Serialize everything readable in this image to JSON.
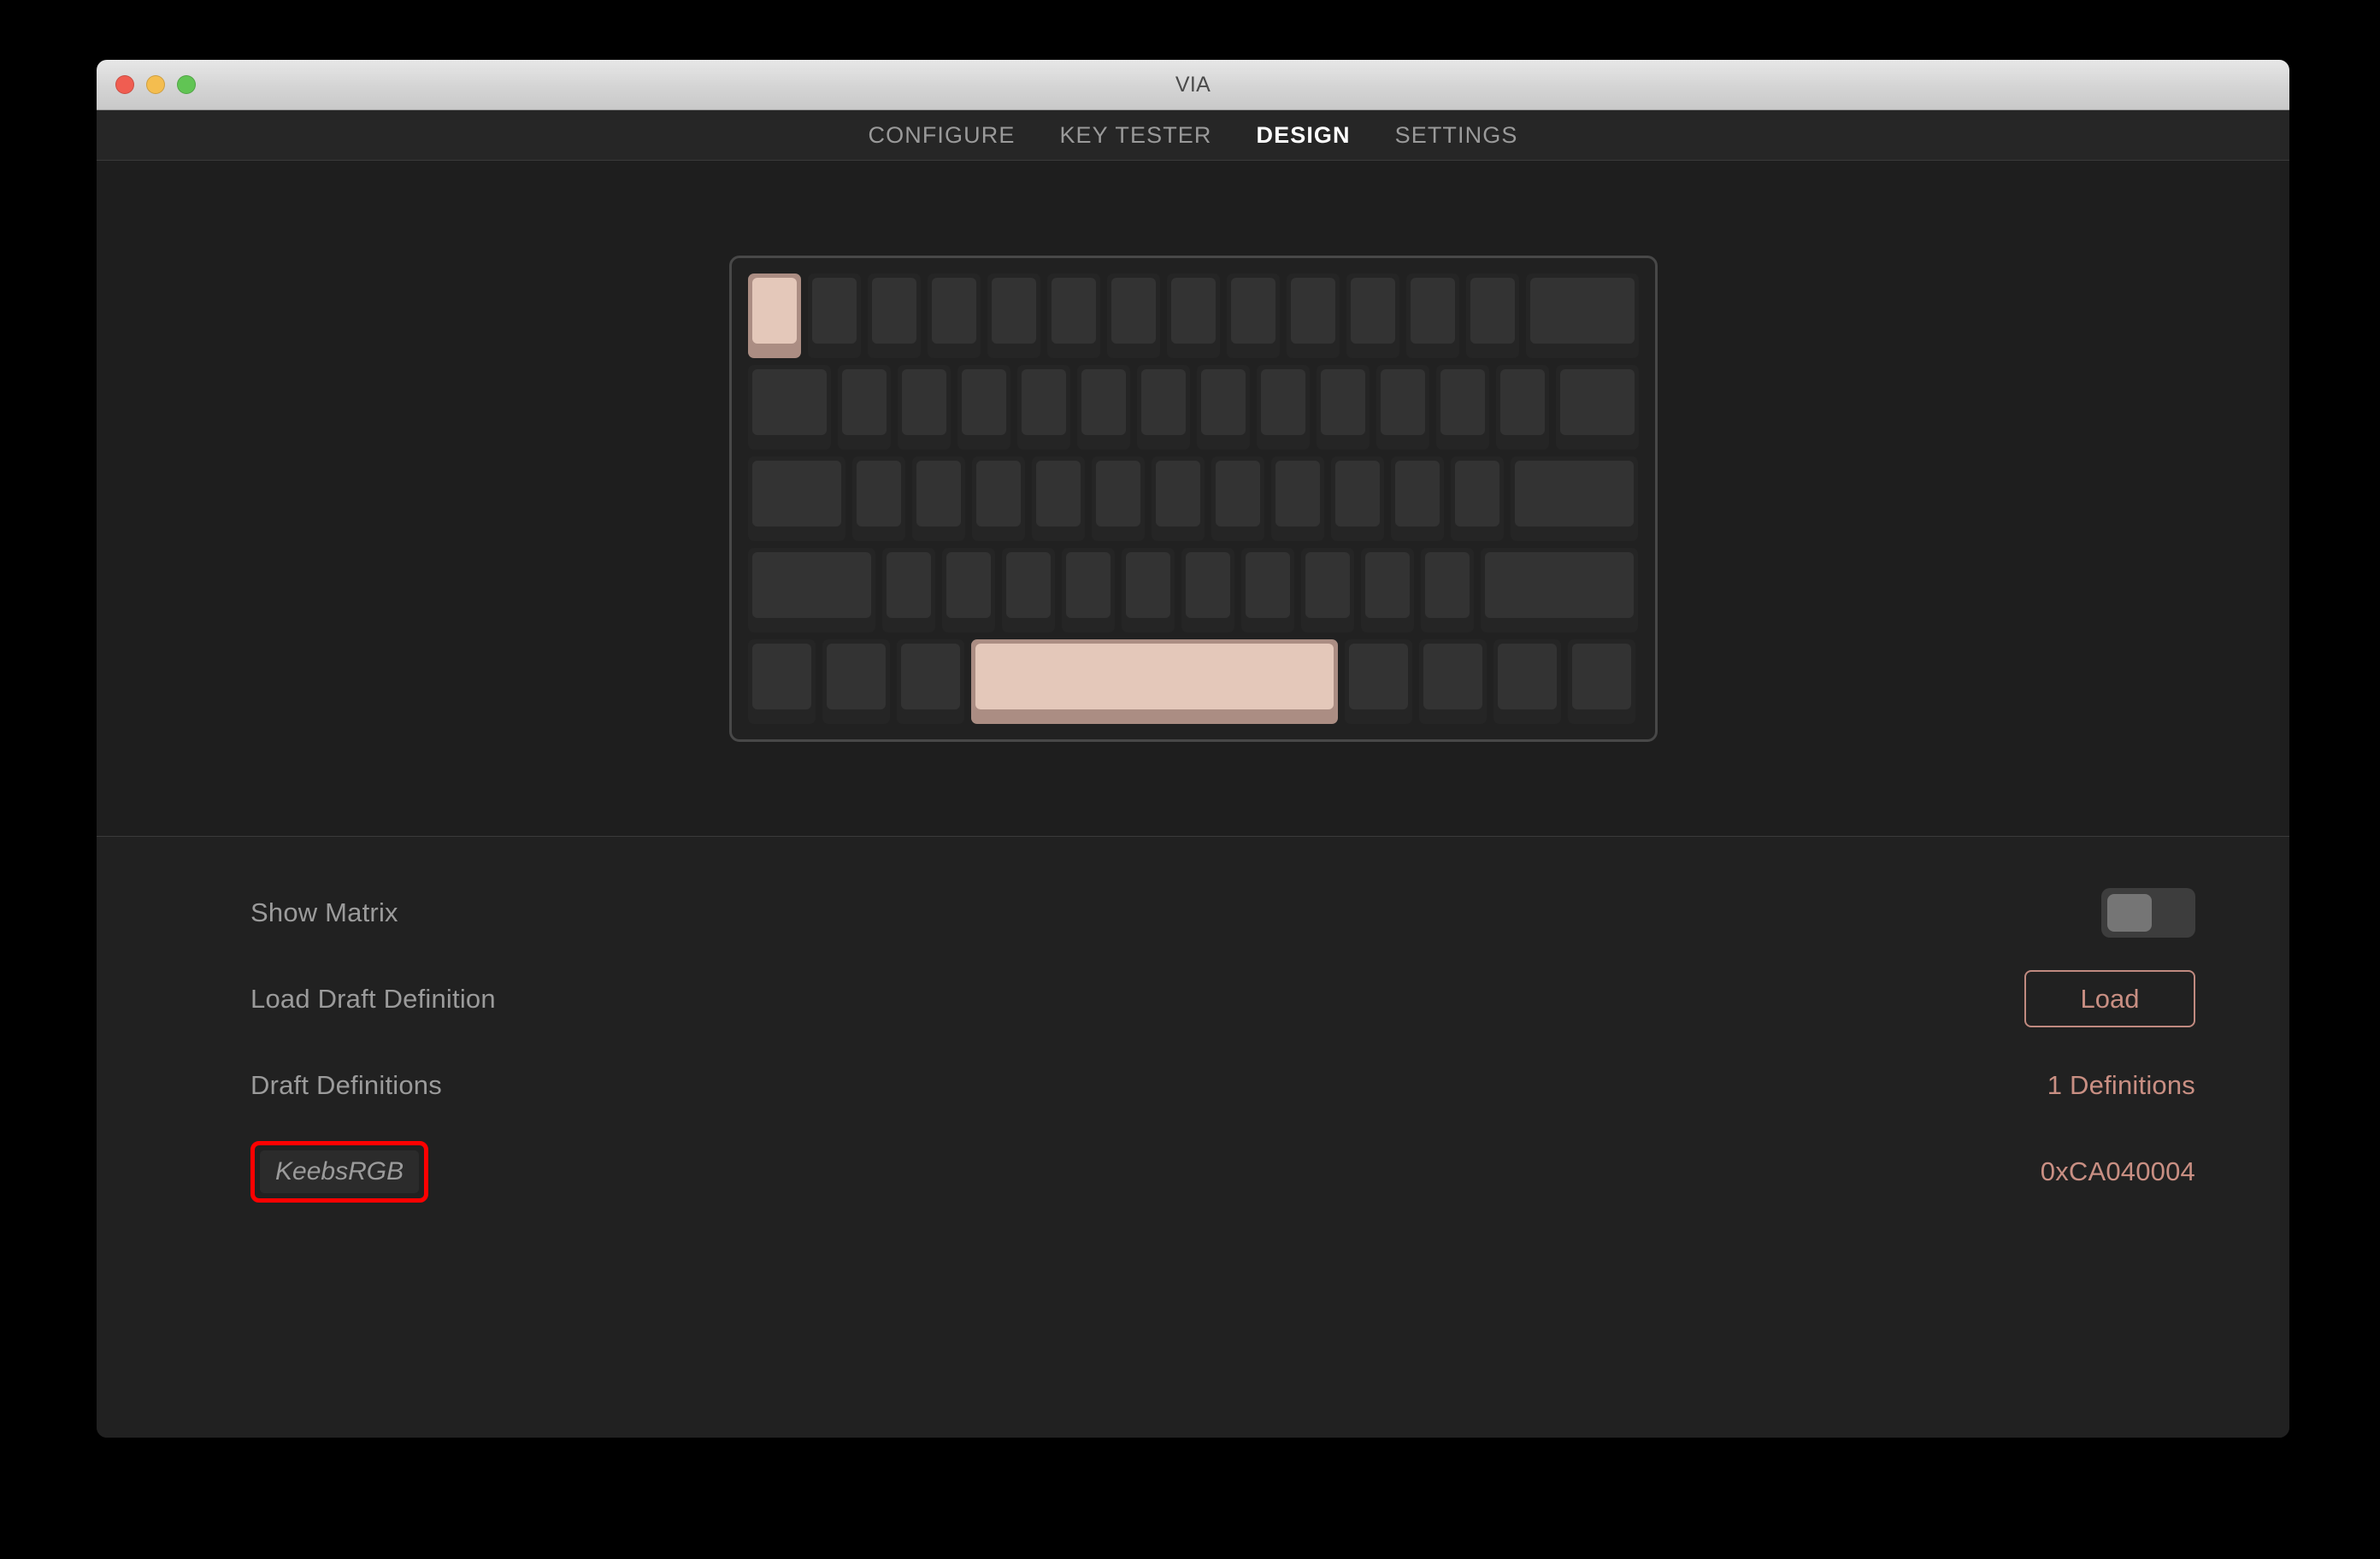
{
  "window": {
    "title": "VIA",
    "traffic_lights": [
      "close",
      "minimize",
      "maximize"
    ]
  },
  "nav": {
    "tabs": [
      {
        "label": "CONFIGURE",
        "active": false
      },
      {
        "label": "KEY TESTER",
        "active": false
      },
      {
        "label": "DESIGN",
        "active": true
      },
      {
        "label": "SETTINGS",
        "active": false
      }
    ]
  },
  "keyboard": {
    "layout_name": "60% ANSI",
    "highlighted_keys": [
      "row1-key1",
      "row5-spacebar"
    ],
    "rows": [
      {
        "keys": [
          {
            "w": "u1",
            "hl": true
          },
          {
            "w": "u1"
          },
          {
            "w": "u1"
          },
          {
            "w": "u1"
          },
          {
            "w": "u1"
          },
          {
            "w": "u1"
          },
          {
            "w": "u1"
          },
          {
            "w": "u1"
          },
          {
            "w": "u1"
          },
          {
            "w": "u1"
          },
          {
            "w": "u1"
          },
          {
            "w": "u1"
          },
          {
            "w": "u1"
          },
          {
            "w": "u2"
          }
        ]
      },
      {
        "keys": [
          {
            "w": "u15"
          },
          {
            "w": "u1"
          },
          {
            "w": "u1"
          },
          {
            "w": "u1"
          },
          {
            "w": "u1"
          },
          {
            "w": "u1"
          },
          {
            "w": "u1"
          },
          {
            "w": "u1"
          },
          {
            "w": "u1"
          },
          {
            "w": "u1"
          },
          {
            "w": "u1"
          },
          {
            "w": "u1"
          },
          {
            "w": "u1"
          },
          {
            "w": "u15"
          }
        ]
      },
      {
        "keys": [
          {
            "w": "u175"
          },
          {
            "w": "u1"
          },
          {
            "w": "u1"
          },
          {
            "w": "u1"
          },
          {
            "w": "u1"
          },
          {
            "w": "u1"
          },
          {
            "w": "u1"
          },
          {
            "w": "u1"
          },
          {
            "w": "u1"
          },
          {
            "w": "u1"
          },
          {
            "w": "u1"
          },
          {
            "w": "u1"
          },
          {
            "w": "u225"
          }
        ]
      },
      {
        "keys": [
          {
            "w": "u225"
          },
          {
            "w": "u1"
          },
          {
            "w": "u1"
          },
          {
            "w": "u1"
          },
          {
            "w": "u1"
          },
          {
            "w": "u1"
          },
          {
            "w": "u1"
          },
          {
            "w": "u1"
          },
          {
            "w": "u1"
          },
          {
            "w": "u1"
          },
          {
            "w": "u1"
          },
          {
            "w": "u275"
          }
        ]
      },
      {
        "keys": [
          {
            "w": "u125"
          },
          {
            "w": "u125"
          },
          {
            "w": "u125"
          },
          {
            "w": "u625",
            "hl": true
          },
          {
            "w": "u125"
          },
          {
            "w": "u125"
          },
          {
            "w": "u125"
          },
          {
            "w": "u125"
          }
        ]
      }
    ]
  },
  "settings": {
    "show_matrix": {
      "label": "Show Matrix",
      "enabled": false
    },
    "load_draft": {
      "label": "Load Draft Definition",
      "button_label": "Load"
    },
    "draft_definitions": {
      "label": "Draft Definitions",
      "count_text": "1 Definitions"
    },
    "definition_entry": {
      "name": "KeebsRGB",
      "id": "0xCA040004"
    }
  },
  "colors": {
    "accent": "#c98f83",
    "annotation": "#ff0000",
    "window_bg": "#212121",
    "stage_bg": "#1e1e1e",
    "key_base": "#252525",
    "key_top": "#333333",
    "key_base_hl": "#ab8d83",
    "key_top_hl": "#e4c8ba"
  }
}
